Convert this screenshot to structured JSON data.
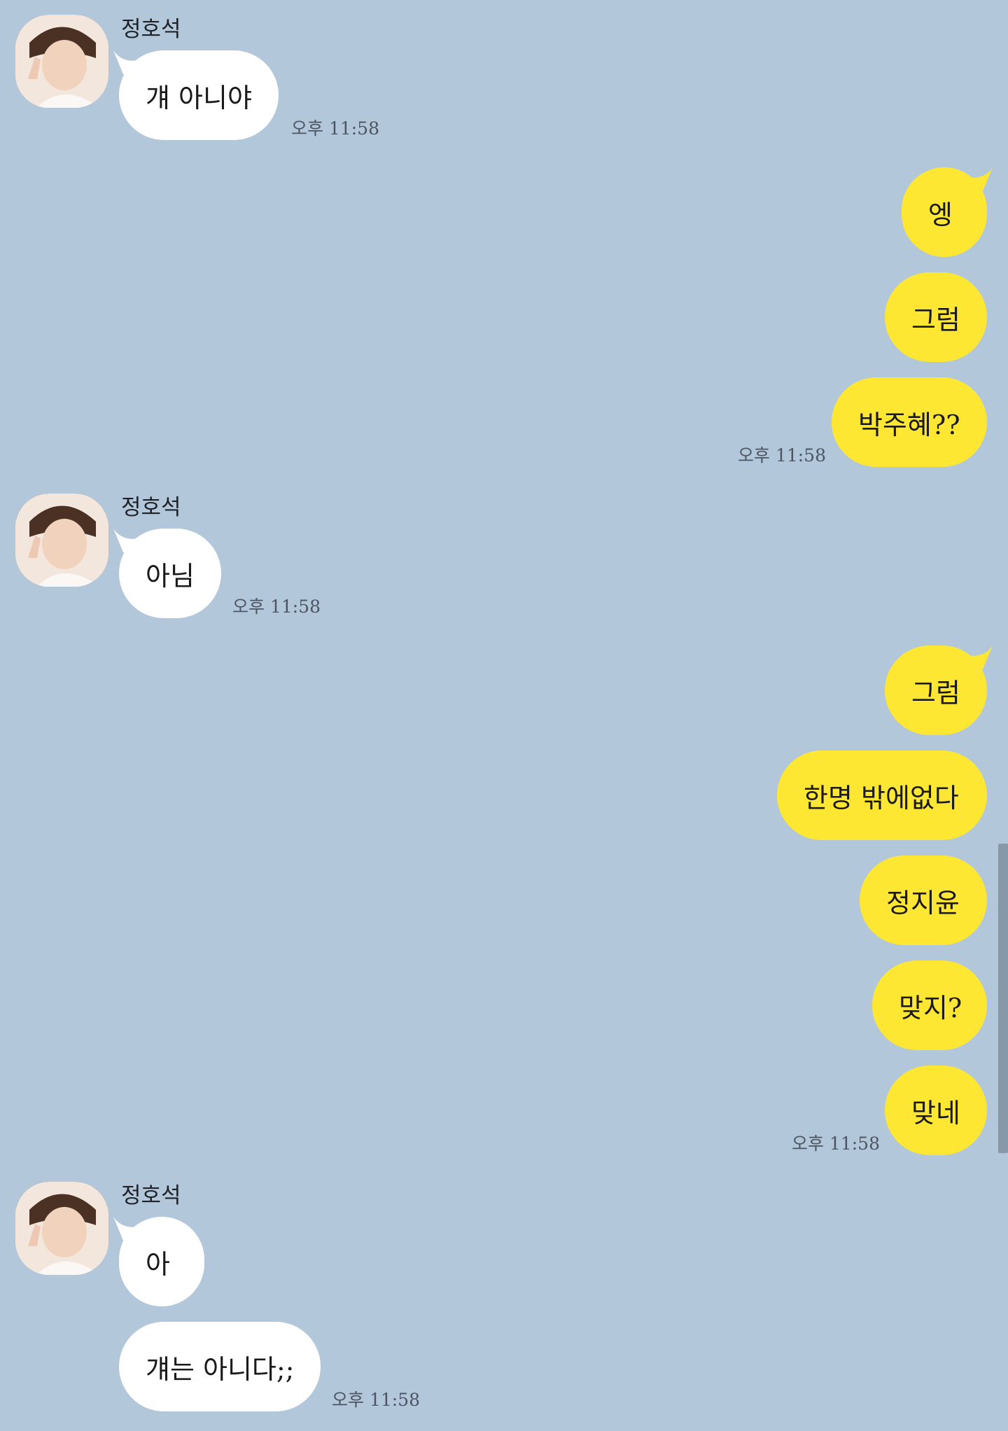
{
  "messages": [
    {
      "type": "in",
      "sender": "정호석",
      "text": "걔 아니야",
      "time": "오후 11:58"
    },
    {
      "type": "out",
      "text": "엥"
    },
    {
      "type": "out",
      "text": "그럼"
    },
    {
      "type": "out",
      "text": "박주혜??",
      "time": "오후 11:58"
    },
    {
      "type": "in",
      "sender": "정호석",
      "text": "아님",
      "time": "오후 11:58"
    },
    {
      "type": "out",
      "text": "그럼"
    },
    {
      "type": "out",
      "text": "한명 밖에없다"
    },
    {
      "type": "out",
      "text": "정지윤"
    },
    {
      "type": "out",
      "text": "맞지?"
    },
    {
      "type": "out",
      "text": "맞네",
      "time": "오후 11:58"
    },
    {
      "type": "in",
      "sender": "정호석",
      "text": "아"
    },
    {
      "type": "in",
      "text": "걔는 아니다;;",
      "time": "오후 11:58"
    }
  ],
  "colors": {
    "background": "#b2c7da",
    "incoming_bubble": "#ffffff",
    "outgoing_bubble": "#fee733"
  },
  "icons": {
    "avatar": "profile-photo"
  }
}
